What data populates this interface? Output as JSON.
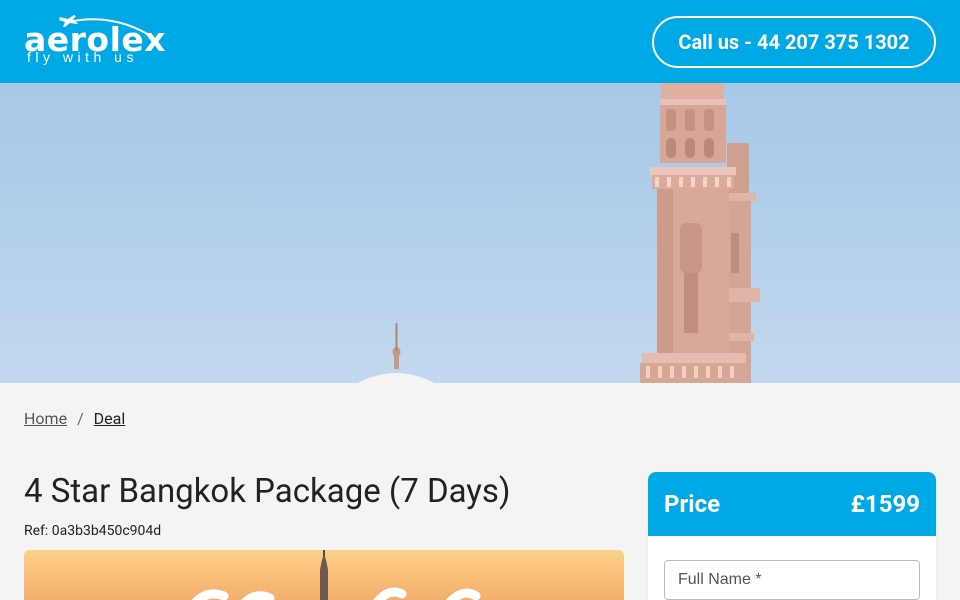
{
  "brand": {
    "logo_text": "aerolex",
    "tagline": "fly with us",
    "primary_color": "#00a8e6"
  },
  "header": {
    "call_label": "Call us - 44 207 375 1302"
  },
  "breadcrumb": {
    "home": "Home",
    "separator": "/",
    "current": "Deal"
  },
  "deal": {
    "title": "4 Star Bangkok Package (7 Days)",
    "ref": "Ref: 0a3b3b450c904d"
  },
  "price_card": {
    "label": "Price",
    "amount": "£1599",
    "full_name_placeholder": "Full Name *"
  }
}
